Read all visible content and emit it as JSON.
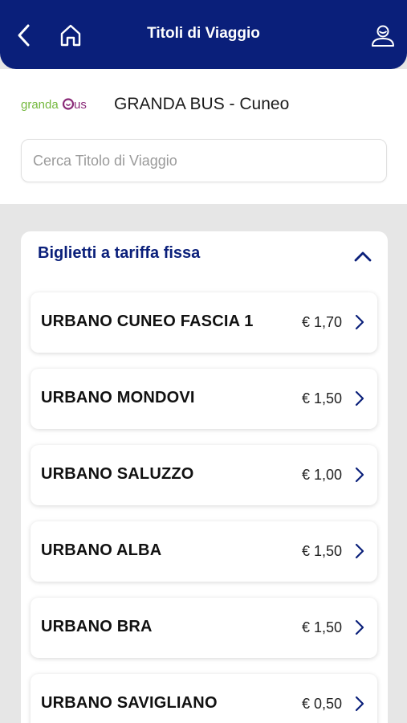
{
  "header": {
    "title": "Titoli di Viaggio",
    "back_icon": "chevron-left-icon",
    "home_icon": "home-icon",
    "user_icon": "user-icon",
    "color": "#0a1f7a"
  },
  "brand": {
    "logo_text": "grandabus",
    "company": "GRANDA BUS - Cuneo"
  },
  "search": {
    "placeholder": "Cerca Titolo di Viaggio",
    "value": ""
  },
  "section": {
    "title": "Biglietti a tariffa fissa",
    "expanded": true
  },
  "tickets": [
    {
      "name": "URBANO CUNEO FASCIA 1",
      "price": "€ 1,70"
    },
    {
      "name": "URBANO MONDOVI",
      "price": "€ 1,50"
    },
    {
      "name": "URBANO SALUZZO",
      "price": "€ 1,00"
    },
    {
      "name": "URBANO ALBA",
      "price": "€ 1,50"
    },
    {
      "name": "URBANO BRA",
      "price": "€ 1,50"
    },
    {
      "name": "URBANO SAVIGLIANO",
      "price": "€ 0,50"
    }
  ]
}
